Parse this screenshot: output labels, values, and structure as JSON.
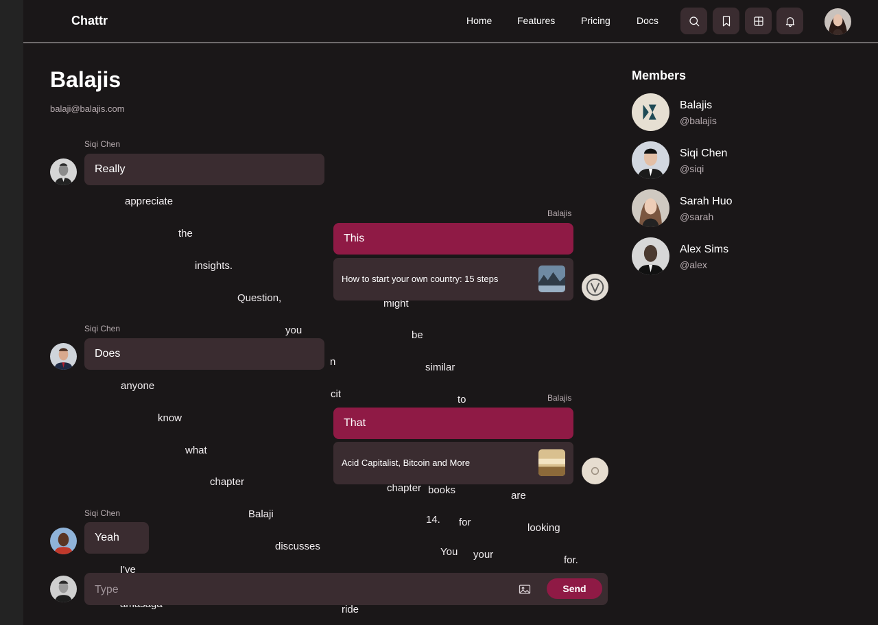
{
  "app": {
    "brand": "Chattr"
  },
  "nav": {
    "items": [
      "Home",
      "Features",
      "Pricing",
      "Docs"
    ]
  },
  "toolbar_icons": [
    "search-icon",
    "bookmark-icon",
    "grid-icon",
    "bell-icon"
  ],
  "channel": {
    "title": "Balajis",
    "email": "balaji@balajis.com"
  },
  "messages": [
    {
      "sender": "Siqi Chen",
      "bubble_text": "Really",
      "overflow_words": [
        "appreciate",
        "the",
        "insights.",
        "Question,",
        "might",
        "you",
        "be",
        "similar",
        "to"
      ]
    },
    {
      "sender": "Balajis",
      "bubble_text": "This",
      "link_title": "How to start your own country: 15 steps",
      "overflow_words": [
        "n",
        "cit",
        "chapter",
        "14.",
        "You",
        "ride"
      ]
    },
    {
      "sender": "Siqi Chen",
      "bubble_text": "Does",
      "overflow_words": [
        "anyone",
        "know",
        "what",
        "chapter",
        "Balaji",
        "discusses"
      ]
    },
    {
      "sender": "Balajis",
      "bubble_text": "That",
      "link_title": "Acid Capitalist, Bitcoin and More",
      "overflow_words": [
        "books",
        "are",
        "for",
        "looking",
        "your",
        "for."
      ]
    },
    {
      "sender": "Siqi Chen",
      "bubble_text": "Yeah",
      "overflow_words": [
        "I've",
        "amasaga"
      ]
    }
  ],
  "members": {
    "title": "Members",
    "list": [
      {
        "name": "Balajis",
        "handle": "@balajis"
      },
      {
        "name": "Siqi Chen",
        "handle": "@siqi"
      },
      {
        "name": "Sarah Huo",
        "handle": "@sarah"
      },
      {
        "name": "Alex Sims",
        "handle": "@alex"
      }
    ]
  },
  "composer": {
    "placeholder": "Type",
    "send_label": "Send"
  },
  "colors": {
    "background": "#1a1718",
    "bubble": "#3a2c30",
    "accent": "#8f1a45",
    "muted": "#b8adb1"
  }
}
